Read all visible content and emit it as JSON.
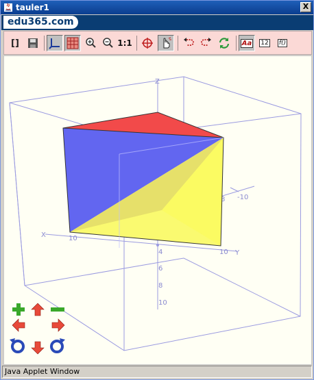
{
  "window": {
    "title": "tauler1",
    "close_glyph": "X"
  },
  "brand": {
    "logo_text": "edu365.com"
  },
  "toolbar": {
    "buttons": [
      {
        "icon": "brackets-icon",
        "label": "[]"
      },
      {
        "icon": "save-icon"
      },
      {
        "icon": "axes-icon",
        "pressed": true
      },
      {
        "icon": "grid-icon",
        "pressed": true
      },
      {
        "icon": "zoom-in-icon"
      },
      {
        "icon": "zoom-out-icon"
      },
      {
        "icon": "zoom-reset-icon",
        "label": "1:1"
      },
      {
        "icon": "target-icon"
      },
      {
        "icon": "hand-pointer-icon",
        "pressed": true
      },
      {
        "icon": "undo-icon"
      },
      {
        "icon": "redo-icon"
      },
      {
        "icon": "refresh-icon"
      },
      {
        "icon": "label-icon",
        "label": "Aa",
        "pressed": true
      },
      {
        "icon": "number-icon",
        "label": "12"
      },
      {
        "icon": "function-icon",
        "label": "f()"
      }
    ]
  },
  "axes": {
    "z_label": "Z",
    "x_label": "X",
    "y_label": "Y",
    "x_tick": "10",
    "y_tick": "10",
    "side_ticks": [
      "-10",
      "8"
    ],
    "z_ticks_below": [
      "4",
      "6",
      "8",
      "10"
    ]
  },
  "colors": {
    "top_face": "#f24a4a",
    "left_face": "#5a5ef5",
    "right_face": "#fbfb62",
    "axis_line": "#8a8ad8",
    "canvas_bg": "#fffff4"
  },
  "nav_controls": {
    "plus": "+",
    "minus": "-"
  },
  "status": {
    "text": "Java Applet Window"
  }
}
